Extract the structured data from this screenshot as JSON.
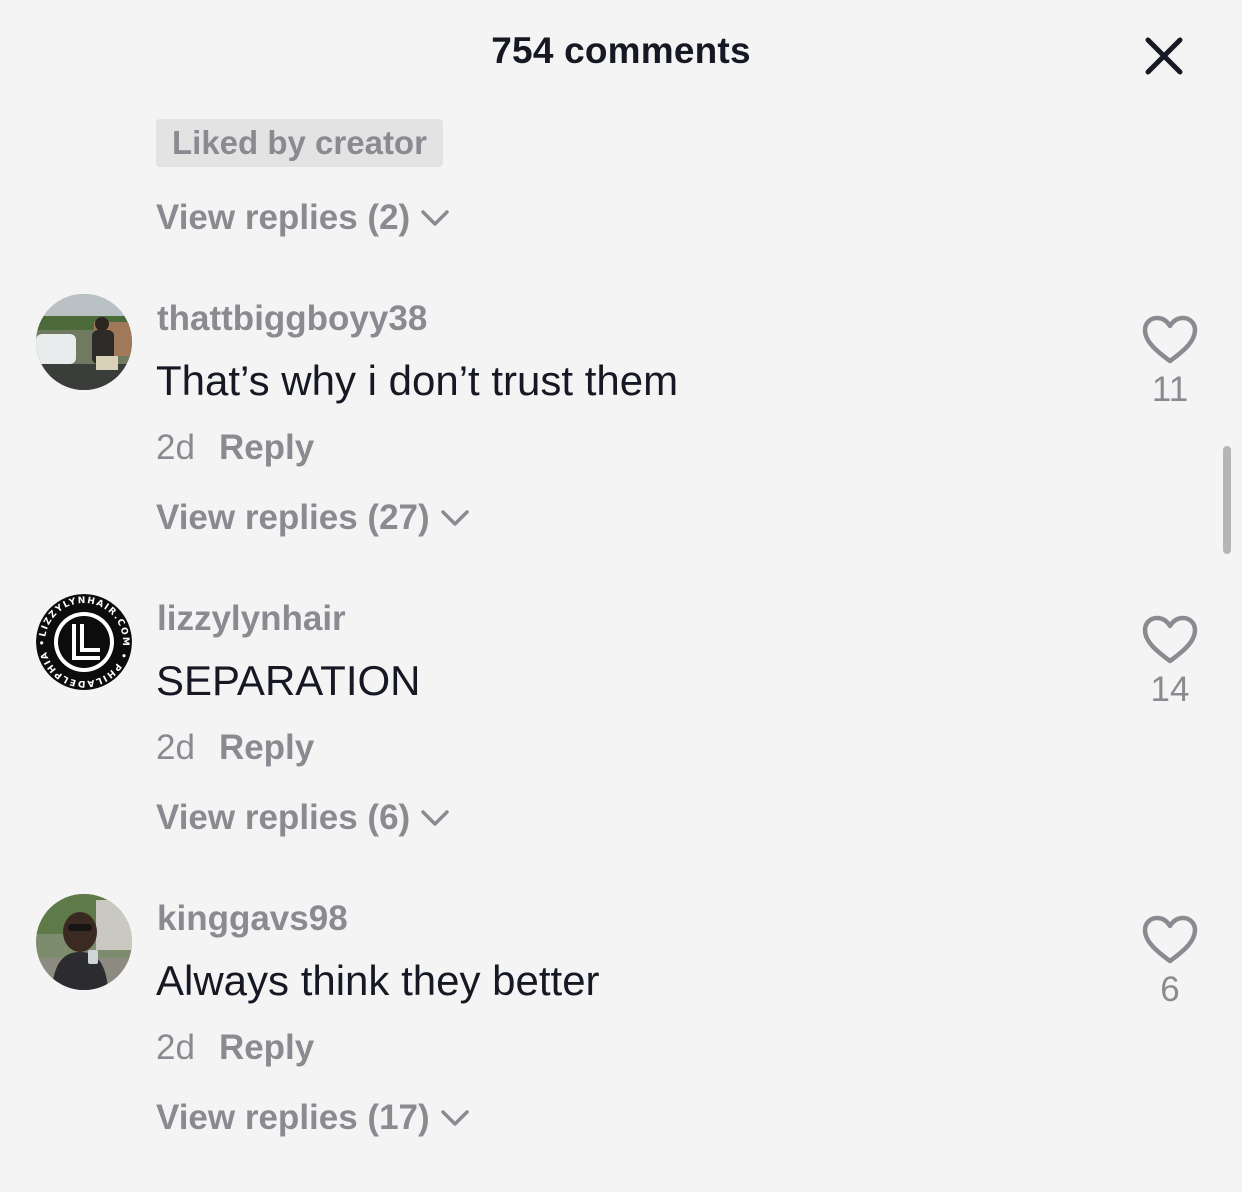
{
  "header": {
    "title": "754 comments",
    "close_icon": "close-icon"
  },
  "top": {
    "badge": "Liked by creator",
    "view_replies": "View replies (2)"
  },
  "comments": [
    {
      "username": "thattbiggboyy38",
      "text": "That’s why i don’t trust them",
      "time": "2d",
      "reply": "Reply",
      "likes": "11",
      "view_replies": "View replies (27)"
    },
    {
      "username": "lizzylynhair",
      "text": "SEPARATION",
      "time": "2d",
      "reply": "Reply",
      "likes": "14",
      "view_replies": "View replies (6)",
      "avatar_logo_text": "LIZZYLYNHAIR.COM • PHILADELPHIA •"
    },
    {
      "username": "kinggavs98",
      "text": "Always think they better",
      "time": "2d",
      "reply": "Reply",
      "likes": "6",
      "view_replies": "View replies (17)"
    }
  ],
  "colors": {
    "background": "#f4f4f4",
    "text": "#161823",
    "muted": "#8a8b91",
    "badge_bg": "#e3e3e4"
  }
}
